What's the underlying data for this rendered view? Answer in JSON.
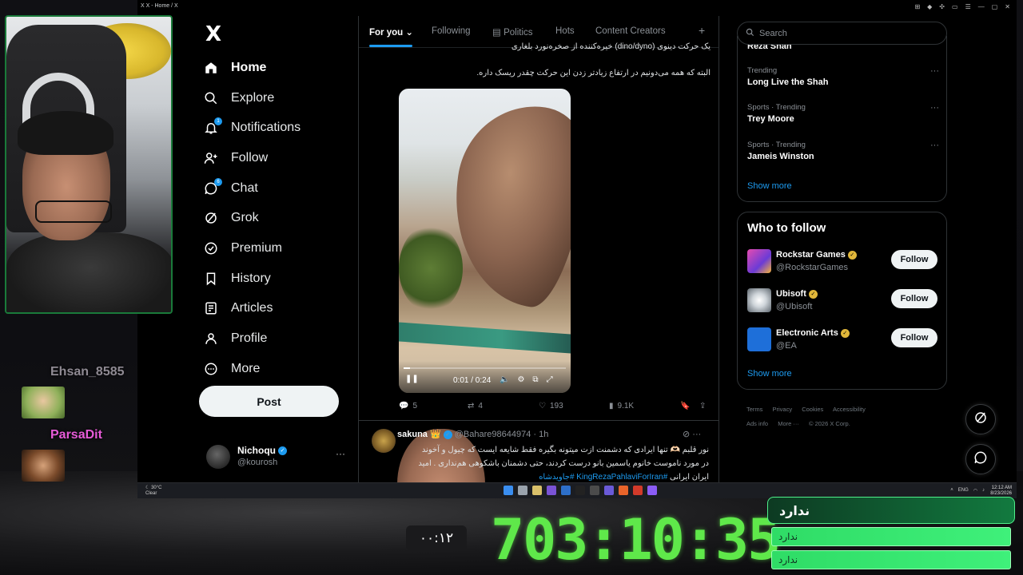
{
  "window": {
    "tab_title": "X  X - Home / X"
  },
  "nav": {
    "logo": "X",
    "items": [
      {
        "label": "Home",
        "icon": "home-icon"
      },
      {
        "label": "Explore",
        "icon": "search-icon"
      },
      {
        "label": "Notifications",
        "icon": "bell-icon",
        "badge": "1"
      },
      {
        "label": "Follow",
        "icon": "add-person-icon"
      },
      {
        "label": "Chat",
        "icon": "chat-icon",
        "badge": "6"
      },
      {
        "label": "Grok",
        "icon": "grok-icon"
      },
      {
        "label": "Premium",
        "icon": "verified-icon"
      },
      {
        "label": "History",
        "icon": "bookmark-icon"
      },
      {
        "label": "Articles",
        "icon": "article-icon"
      },
      {
        "label": "Profile",
        "icon": "person-icon"
      },
      {
        "label": "More",
        "icon": "more-circle-icon"
      }
    ],
    "post_label": "Post",
    "account": {
      "name": "Nichoqu",
      "handle": "@kourosh",
      "more": "···"
    }
  },
  "feed": {
    "tabs": [
      "For you",
      "Following",
      "Politics",
      "Hots",
      "Content Creators"
    ],
    "plus": "+",
    "post1": {
      "text_top": "یک حرکت دینوی (dino/dyno) خیره‌کننده از صخره‌نورد بلغاری",
      "text_2": "البته که همه می‌دونیم در ارتفاع زیادتر زدن این حرکت چقدر ریسک داره.",
      "video": {
        "time": "0:01 / 0:24",
        "progress": 0.04
      },
      "actions": {
        "replies": "5",
        "reposts": "4",
        "likes": "193",
        "views": "9.1K"
      }
    },
    "post2": {
      "name": "sakuna 👑",
      "handle": "@Bahare98644974 · 1h",
      "line1": "نور قلبم 🫶🏻 تنها ایرادی که دشمنت ازت میتونه بگیره فقط شایعه ایست که چیول و آخوند",
      "line2": "در مورد ناموست خانوم یاسمین بانو درست کردند، حتی دشمنان باشکوهی هم‌نداری . امید",
      "line3_text": "ایران ایرانی",
      "line3_tag": "#KingRezaPahlaviForIran #جاویدشاه"
    }
  },
  "sidebar": {
    "search_placeholder": "Search",
    "trend_cut": "Reza Shah",
    "trends": [
      {
        "category": "Trending",
        "title": "Long Live the Shah"
      },
      {
        "category": "Sports · Trending",
        "title": "Trey Moore"
      },
      {
        "category": "Sports · Trending",
        "title": "Jameis Winston"
      }
    ],
    "show_more": "Show more",
    "who_to_follow_title": "Who to follow",
    "who": [
      {
        "name": "Rockstar Games",
        "handle": "@RockstarGames",
        "btn": "Follow"
      },
      {
        "name": "Ubisoft",
        "handle": "@Ubisoft",
        "btn": "Follow"
      },
      {
        "name": "Electronic Arts",
        "handle": "@EA",
        "btn": "Follow"
      }
    ],
    "show_more_2": "Show more",
    "footer_1": [
      "Terms",
      "Privacy",
      "Cookies",
      "Accessibility"
    ],
    "footer_2": [
      "Ads info",
      "More ···",
      "© 2026 X Corp."
    ]
  },
  "taskbar": {
    "weather_temp": "30°C",
    "weather_desc": "Clear",
    "lang": "ENG",
    "time": "12:12 AM",
    "date": "8/23/2026"
  },
  "overlay": {
    "chat_user_1": "Ehsan_8585",
    "chat_user_2": "ParsaDit",
    "small_timer": "۰۰:۱۲",
    "big_timer": "703:10:35",
    "goal_title": "ندارد",
    "goal_1": "ندارد",
    "goal_2": "ندارد"
  },
  "colors": {
    "accent": "#1d9bf0",
    "timer": "#5fe84a",
    "chat_name": "#e75bd8"
  }
}
